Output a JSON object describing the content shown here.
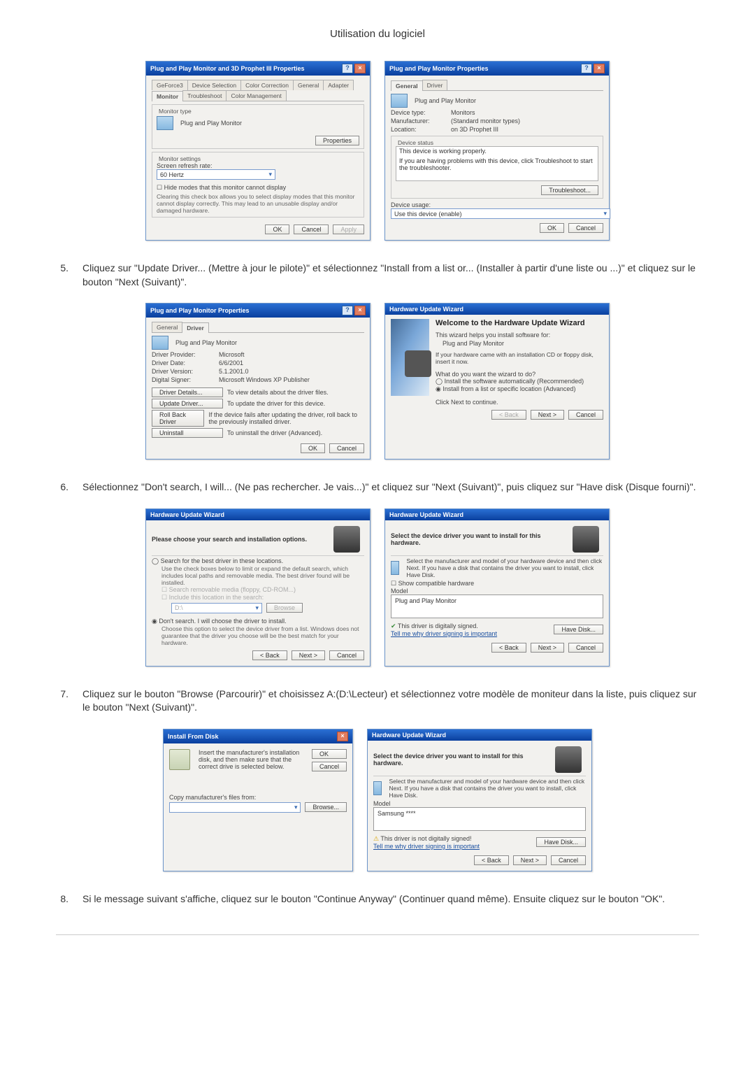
{
  "page": {
    "title": "Utilisation du logiciel"
  },
  "instructions": {
    "step5": {
      "num": "5.",
      "text": "Cliquez sur \"Update Driver... (Mettre à jour le pilote)\" et sélectionnez \"Install from a list or... (Installer à partir d'une liste ou ...)\" et cliquez sur le bouton \"Next (Suivant)\"."
    },
    "step6": {
      "num": "6.",
      "text": "Sélectionnez \"Don't search, I will... (Ne pas rechercher. Je vais...)\" et cliquez sur \"Next (Suivant)\", puis cliquez sur \"Have disk (Disque fourni)\"."
    },
    "step7": {
      "num": "7.",
      "text": "Cliquez sur le bouton \"Browse (Parcourir)\" et choisissez A:(D:\\Lecteur) et sélectionnez votre modèle de moniteur dans la liste, puis cliquez sur le bouton \"Next (Suivant)\"."
    },
    "step8": {
      "num": "8.",
      "text": "Si le message suivant s'affiche, cliquez sur le bouton \"Continue Anyway\" (Continuer quand même). Ensuite cliquez sur le bouton \"OK\"."
    }
  },
  "dlg_a1": {
    "title": "Plug and Play Monitor and 3D Prophet III Properties",
    "tabs": {
      "geforce": "GeForce3",
      "device": "Device Selection",
      "color": "Color Correction",
      "general": "General",
      "adapter": "Adapter",
      "monitor": "Monitor",
      "troubleshoot": "Troubleshoot",
      "colormgmt": "Color Management"
    },
    "monitor_type_label": "Monitor type",
    "monitor_name": "Plug and Play Monitor",
    "properties_btn": "Properties",
    "settings_label": "Monitor settings",
    "refresh_label": "Screen refresh rate:",
    "refresh_value": "60 Hertz",
    "hide_checkbox": "Hide modes that this monitor cannot display",
    "hide_desc": "Clearing this check box allows you to select display modes that this monitor cannot display correctly. This may lead to an unusable display and/or damaged hardware.",
    "ok": "OK",
    "cancel": "Cancel",
    "apply": "Apply"
  },
  "dlg_a2": {
    "title": "Plug and Play Monitor Properties",
    "tab_general": "General",
    "tab_driver": "Driver",
    "monitor_name": "Plug and Play Monitor",
    "devtype_lbl": "Device type:",
    "devtype_val": "Monitors",
    "manuf_lbl": "Manufacturer:",
    "manuf_val": "(Standard monitor types)",
    "loc_lbl": "Location:",
    "loc_val": "on 3D Prophet III",
    "status_title": "Device status",
    "status_text": "This device is working properly.",
    "status_help": "If you are having problems with this device, click Troubleshoot to start the troubleshooter.",
    "troubleshoot_btn": "Troubleshoot...",
    "usage_lbl": "Device usage:",
    "usage_val": "Use this device (enable)",
    "ok": "OK",
    "cancel": "Cancel"
  },
  "dlg_b1": {
    "title": "Plug and Play Monitor Properties",
    "tab_general": "General",
    "tab_driver": "Driver",
    "monitor_name": "Plug and Play Monitor",
    "provider_lbl": "Driver Provider:",
    "provider_val": "Microsoft",
    "date_lbl": "Driver Date:",
    "date_val": "6/6/2001",
    "version_lbl": "Driver Version:",
    "version_val": "5.1.2001.0",
    "signer_lbl": "Digital Signer:",
    "signer_val": "Microsoft Windows XP Publisher",
    "details_btn": "Driver Details...",
    "details_desc": "To view details about the driver files.",
    "update_btn": "Update Driver...",
    "update_desc": "To update the driver for this device.",
    "rollback_btn": "Roll Back Driver",
    "rollback_desc": "If the device fails after updating the driver, roll back to the previously installed driver.",
    "uninstall_btn": "Uninstall",
    "uninstall_desc": "To uninstall the driver (Advanced).",
    "ok": "OK",
    "cancel": "Cancel"
  },
  "dlg_b2": {
    "title": "Hardware Update Wizard",
    "heading": "Welcome to the Hardware Update Wizard",
    "sub": "This wizard helps you install software for:",
    "device": "Plug and Play Monitor",
    "tip": "If your hardware came with an installation CD or floppy disk, insert it now.",
    "question": "What do you want the wizard to do?",
    "opt1": "Install the software automatically (Recommended)",
    "opt2": "Install from a list or specific location (Advanced)",
    "continue_text": "Click Next to continue.",
    "back": "< Back",
    "next": "Next >",
    "cancel": "Cancel"
  },
  "dlg_c1": {
    "title": "Hardware Update Wizard",
    "heading": "Please choose your search and installation options.",
    "opt_search": "Search for the best driver in these locations.",
    "opt_search_desc": "Use the check boxes below to limit or expand the default search, which includes local paths and removable media. The best driver found will be installed.",
    "chk1": "Search removable media (floppy, CD-ROM...)",
    "chk2": "Include this location in the search:",
    "path_value": "D:\\",
    "browse_btn": "Browse",
    "opt_dont": "Don't search. I will choose the driver to install.",
    "opt_dont_desc": "Choose this option to select the device driver from a list. Windows does not guarantee that the driver you choose will be the best match for your hardware.",
    "back": "< Back",
    "next": "Next >",
    "cancel": "Cancel"
  },
  "dlg_c2": {
    "title": "Hardware Update Wizard",
    "heading": "Select the device driver you want to install for this hardware.",
    "desc": "Select the manufacturer and model of your hardware device and then click Next. If you have a disk that contains the driver you want to install, click Have Disk.",
    "compat_chk": "Show compatible hardware",
    "model_lbl": "Model",
    "model_item": "Plug and Play Monitor",
    "signed_text": "This driver is digitally signed.",
    "tell_link": "Tell me why driver signing is important",
    "havedisk_btn": "Have Disk...",
    "back": "< Back",
    "next": "Next >",
    "cancel": "Cancel"
  },
  "dlg_d1": {
    "title": "Install From Disk",
    "text": "Insert the manufacturer's installation disk, and then make sure that the correct drive is selected below.",
    "ok": "OK",
    "cancel": "Cancel",
    "copy_lbl": "Copy manufacturer's files from:",
    "path": "",
    "browse": "Browse..."
  },
  "dlg_d2": {
    "title": "Hardware Update Wizard",
    "heading": "Select the device driver you want to install for this hardware.",
    "desc": "Select the manufacturer and model of your hardware device and then click Next. If you have a disk that contains the driver you want to install, click Have Disk.",
    "model_lbl": "Model",
    "model_item": "Samsung ****",
    "notsigned_text": "This driver is not digitally signed!",
    "tell_link": "Tell me why driver signing is important",
    "havedisk_btn": "Have Disk...",
    "back": "< Back",
    "next": "Next >",
    "cancel": "Cancel"
  }
}
